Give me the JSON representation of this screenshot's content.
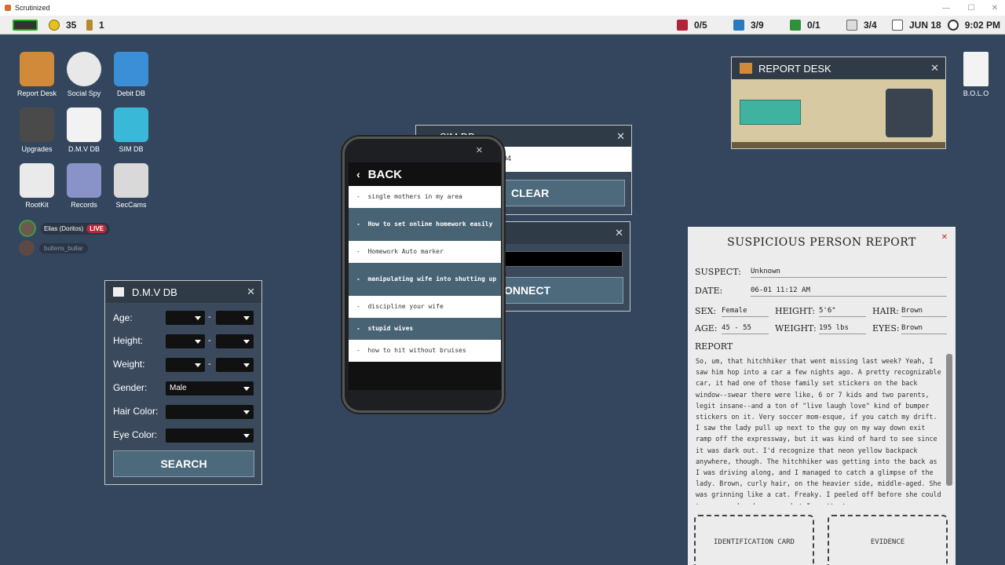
{
  "window": {
    "title": "Scrutinized"
  },
  "hud": {
    "coins": "35",
    "keys": "1",
    "cases": "0/5",
    "reports": "3/9",
    "cards": "0/1",
    "notes": "3/4",
    "date": "JUN 18",
    "time": "9:02 PM"
  },
  "desktop": {
    "icons": [
      {
        "label": "Report Desk",
        "icon": "report-desk-icon"
      },
      {
        "label": "Social Spy",
        "icon": "social-spy-icon"
      },
      {
        "label": "Debit DB",
        "icon": "debit-db-icon"
      },
      {
        "label": "Upgrades",
        "icon": "upgrades-icon"
      },
      {
        "label": "D.M.V DB",
        "icon": "dmv-db-icon"
      },
      {
        "label": "SIM DB",
        "icon": "sim-db-icon"
      },
      {
        "label": "RootKit",
        "icon": "rootkit-icon"
      },
      {
        "label": "Records",
        "icon": "records-icon"
      },
      {
        "label": "SecCams",
        "icon": "seccams-icon"
      }
    ],
    "bolo_label": "B.O.L.O"
  },
  "stream": {
    "user1": "Elias (Doritos)",
    "live": "LIVE",
    "user2": "bultens_bullar"
  },
  "dmv": {
    "title": "D.M.V DB",
    "age": "Age:",
    "height": "Height:",
    "weight": "Weight:",
    "gender": "Gender:",
    "gender_value": "Male",
    "hair": "Hair Color:",
    "eye": "Eye Color:",
    "search": "SEARCH",
    "dash": "-"
  },
  "sim": {
    "title": "SIM DB",
    "value": "04",
    "clear": "CLEAR",
    "connect": "ONNECT"
  },
  "report_desk": {
    "title": "REPORT DESK"
  },
  "phone": {
    "back": "BACK",
    "items": [
      "single mothers in my area",
      "How to set online homework easily",
      "Homework Auto marker",
      "manipulating wife into shutting up",
      "discipline your wife",
      "stupid wives",
      "how to hit without bruises"
    ]
  },
  "report": {
    "title": "SUSPICIOUS PERSON REPORT",
    "suspect_label": "SUSPECT:",
    "suspect": "Unknown",
    "date_label": "DATE:",
    "date": "06-01 11:12 AM",
    "sex_label": "SEX:",
    "sex": "Female",
    "height_label": "HEIGHT:",
    "height": "5'6\"",
    "hair_label": "HAIR:",
    "hair": "Brown",
    "age_label": "AGE:",
    "age": "45 - 55",
    "weight_label": "WEIGHT:",
    "weight": "195 lbs",
    "eyes_label": "EYES:",
    "eyes": "Brown",
    "report_label": "REPORT",
    "text": "So, um, that hitchhiker that went missing last week? Yeah, I saw him hop into a car a few nights ago. A pretty recognizable car, it had one of those family set stickers on the back window--swear there were like, 6 or 7 kids and two parents, legit insane--and a ton of \"live laugh love\" kind of bumper stickers on it. Very soccer mom-esque, if you catch my drift. I saw the lady pull up next to the guy on my way down exit ramp off the expressway, but it was kind of hard to see since it was dark out. I'd recognize that neon yellow backpack anywhere, though. The hitchhiker was getting into the back as I was driving along, and I managed to catch a glimpse of the lady. Brown, curly hair, on the heavier side, middle-aged. She was grinning like a cat. Freaky. I peeled off before she could turn around and see me, but I can't stop",
    "id_card": "IDENTIFICATION CARD",
    "evidence": "EVIDENCE"
  }
}
